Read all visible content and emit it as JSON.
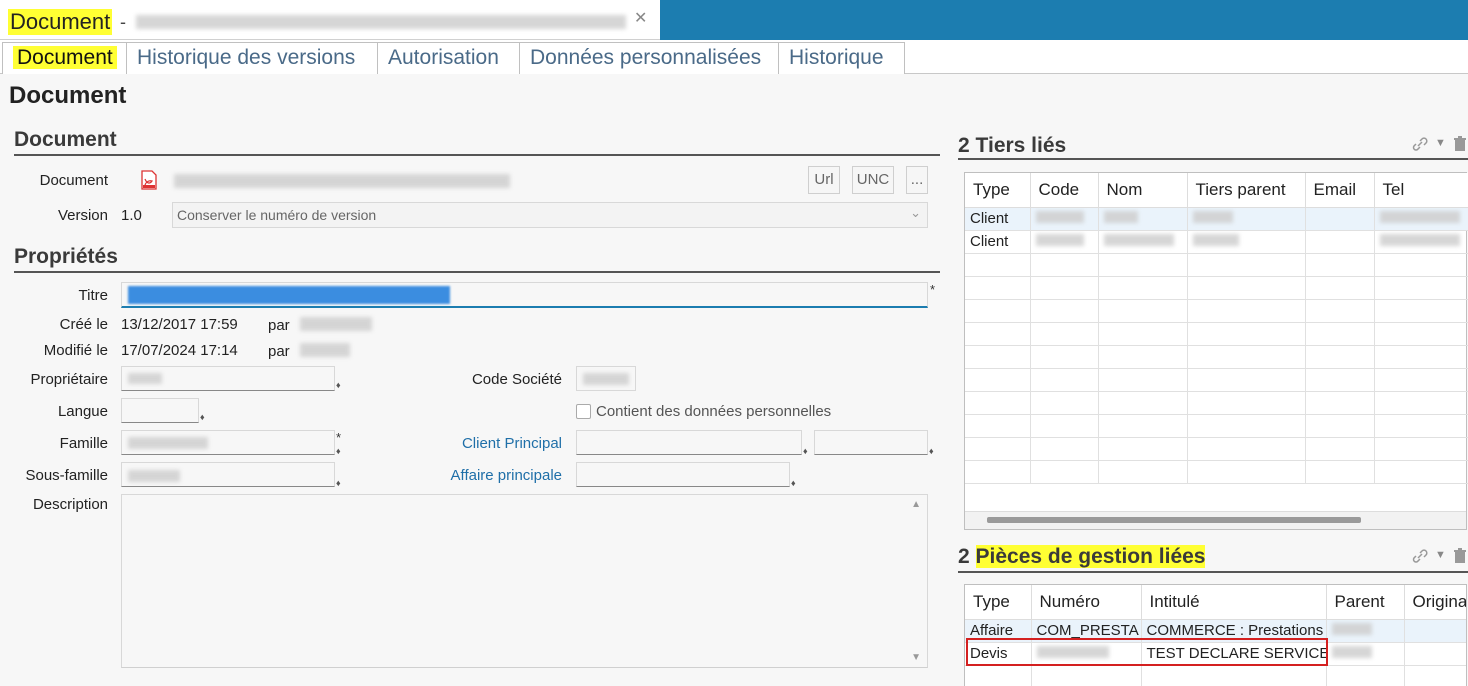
{
  "window": {
    "tab_title": "Document",
    "separator": "-"
  },
  "tabs": [
    "Document",
    "Historique des versions",
    "Autorisation",
    "Données personnalisées",
    "Historique"
  ],
  "page_title": "Document",
  "document_section": {
    "heading": "Document",
    "document_label": "Document",
    "buttons": {
      "url": "Url",
      "unc": "UNC",
      "more": "..."
    },
    "version_label": "Version",
    "version_value": "1.0",
    "version_option": "Conserver le numéro de version"
  },
  "properties": {
    "heading": "Propriétés",
    "titre_label": "Titre",
    "cree_label": "Créé le",
    "cree_value": "13/12/2017 17:59",
    "par_label": "par",
    "modifie_label": "Modifié le",
    "modifie_value": "17/07/2024 17:14",
    "proprietaire_label": "Propriétaire",
    "code_societe_label": "Code Société",
    "langue_label": "Langue",
    "perso_checkbox_label": "Contient des données personnelles",
    "famille_label": "Famille",
    "client_principal_label": "Client Principal",
    "sous_famille_label": "Sous-famille",
    "affaire_principale_label": "Affaire principale",
    "description_label": "Description",
    "required_mark": "*"
  },
  "tiers": {
    "count": "2",
    "title": "Tiers liés",
    "columns": [
      "Type",
      "Code",
      "Nom",
      "Tiers parent",
      "Email",
      "Tel"
    ],
    "rows": [
      {
        "type": "Client"
      },
      {
        "type": "Client"
      }
    ]
  },
  "pieces": {
    "count": "2",
    "title": "Pièces de gestion liées",
    "columns": [
      "Type",
      "Numéro",
      "Intitulé",
      "Parent",
      "Origina"
    ],
    "rows": [
      {
        "type": "Affaire",
        "numero": "COM_PRESTA",
        "intitule": "COMMERCE : Prestations"
      },
      {
        "type": "Devis",
        "numero": "",
        "intitule": "TEST DECLARE SERVICES"
      }
    ]
  },
  "colors": {
    "accent": "#1c7db0",
    "highlight": "#ffff33",
    "link": "#1f6fa8",
    "annotation": "#d42020"
  },
  "icons": [
    "close-icon",
    "pdf-icon",
    "chevron-down-icon",
    "link-icon",
    "trash-icon",
    "map-pin-icon",
    "scroll-up-icon",
    "scroll-down-icon"
  ]
}
